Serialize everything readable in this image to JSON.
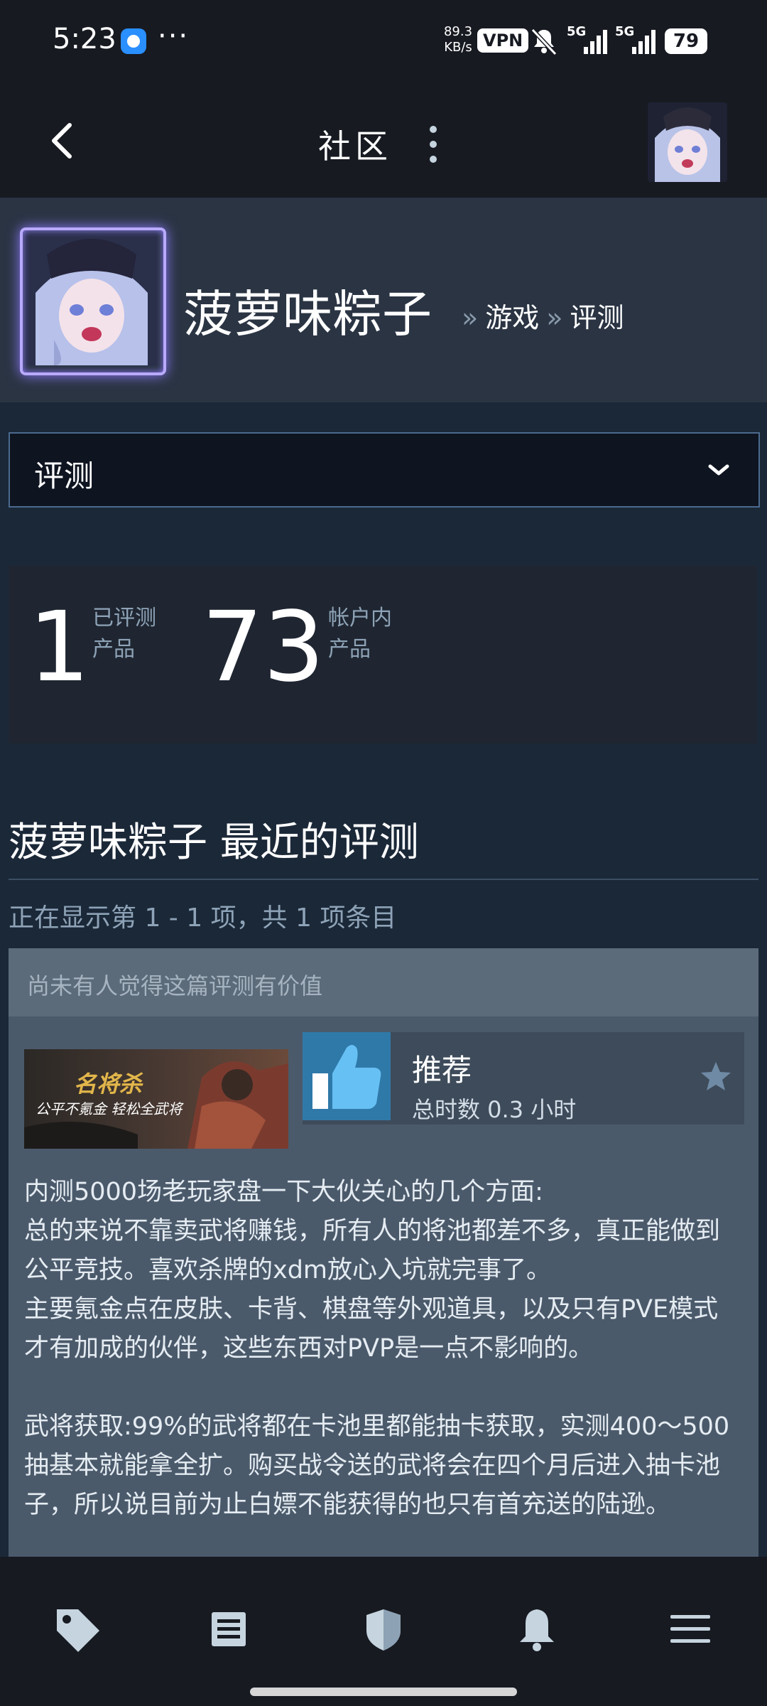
{
  "status_bar": {
    "time": "5:23",
    "more": "···",
    "speed_value": "89.3",
    "speed_unit": "KB/s",
    "vpn": "VPN",
    "sim1": "5G",
    "sim2": "5G",
    "battery": "79"
  },
  "header": {
    "title": "社区"
  },
  "profile": {
    "name": "菠萝味粽子",
    "crumb_sep": "»",
    "crumb_games": "游戏",
    "crumb_reviews": "评测"
  },
  "filter": {
    "selected": "评测"
  },
  "stats": {
    "reviewed_count": "1",
    "reviewed_label_1": "已评测",
    "reviewed_label_2": "产品",
    "owned_count": "73",
    "owned_label_1": "帐户内",
    "owned_label_2": "产品"
  },
  "section": {
    "title": "菠萝味粽子 最近的评测",
    "showing": "正在显示第 1 - 1 项，共 1 项条目"
  },
  "review": {
    "helpful": "尚未有人觉得这篇评测有价值",
    "game_logo_text": "名将杀",
    "game_tagline": "公平不氪金 轻松全武将",
    "recommendation": "推荐",
    "hours": "总时数 0.3 小时",
    "body": "内测5000场老玩家盘一下大伙关心的几个方面:\n总的来说不靠卖武将赚钱，所有人的将池都差不多，真正能做到公平竞技。喜欢杀牌的xdm放心入坑就完事了。\n主要氪金点在皮肤、卡背、棋盘等外观道具，以及只有PVE模式才有加成的伙伴，这些东西对PVP是一点不影响的。\n\n武将获取:99%的武将都在卡池里都能抽卡获取，实测400～500抽基本就能拿全扩。购买战令送的武将会在四个月后进入抽卡池子，所以说目前为止白嫖不能获得的也只有首充送的陆逊。"
  },
  "colors": {
    "background": "#1b2838",
    "header": "#171a21",
    "accent": "#2f79a9"
  }
}
